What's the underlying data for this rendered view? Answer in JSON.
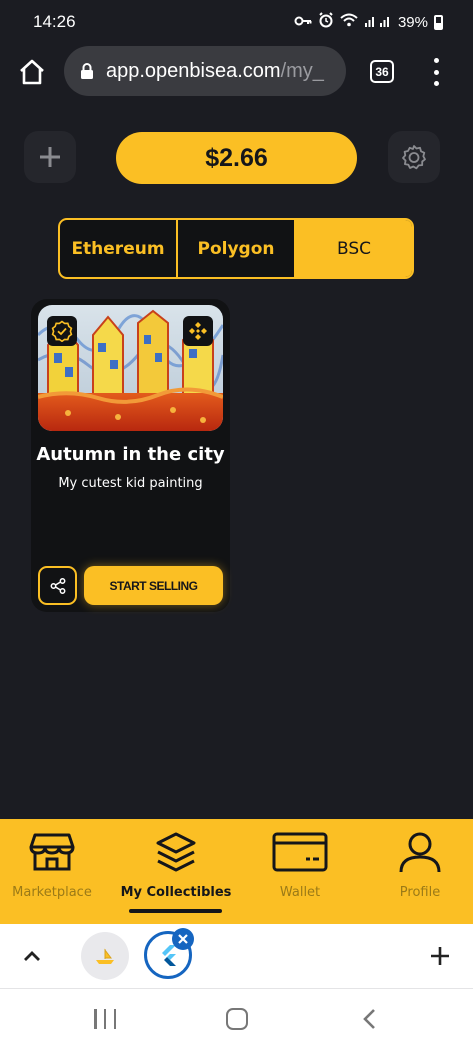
{
  "status_bar": {
    "time": "14:26",
    "battery": "39%"
  },
  "browser": {
    "url_host": "app.openbisea.com",
    "url_path": "/my_",
    "tab_count": "36"
  },
  "header": {
    "balance": "$2.66"
  },
  "network_tabs": [
    {
      "label": "Ethereum",
      "active": false
    },
    {
      "label": "Polygon",
      "active": false
    },
    {
      "label": "BSC",
      "active": true
    }
  ],
  "card": {
    "title": "Autumn in the city",
    "description": "My cutest kid painting",
    "sell_label": "START SELLING"
  },
  "bottom_nav": [
    {
      "label": "Marketplace",
      "icon": "store-icon",
      "active": false
    },
    {
      "label": "My Collectibles",
      "icon": "layers-icon",
      "active": true
    },
    {
      "label": "Wallet",
      "icon": "wallet-card-icon",
      "active": false
    },
    {
      "label": "Profile",
      "icon": "user-icon",
      "active": false
    }
  ],
  "colors": {
    "accent": "#fbbf24",
    "background": "#1b1c22",
    "card": "#111214"
  }
}
